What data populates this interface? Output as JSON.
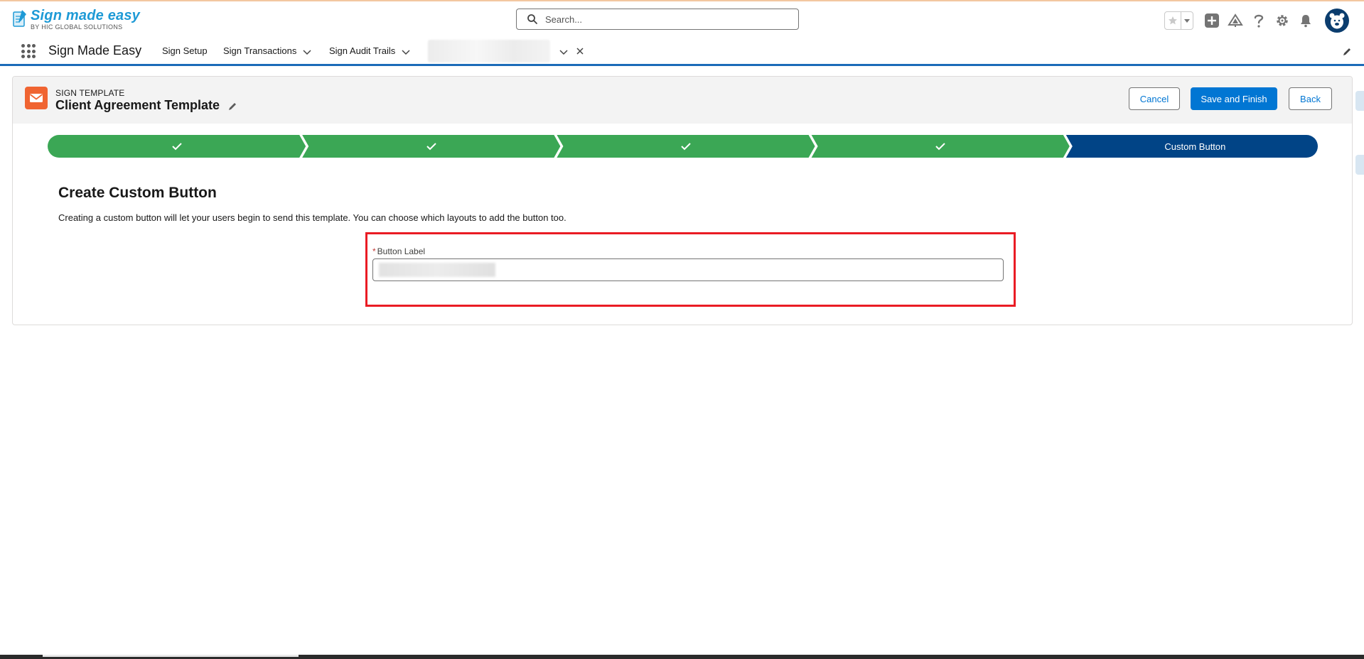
{
  "branding": {
    "logo_title": "Sign made easy",
    "logo_subtitle": "BY HIC GLOBAL SOLUTIONS"
  },
  "search": {
    "placeholder": "Search..."
  },
  "header_icons": [
    "favorites-star-icon",
    "favorites-dropdown-icon",
    "global-actions-plus-icon",
    "trailhead-icon",
    "help-icon",
    "setup-gear-icon",
    "notifications-bell-icon",
    "user-avatar"
  ],
  "nav": {
    "app_name": "Sign Made Easy",
    "items": [
      {
        "label": "Sign Setup",
        "has_menu": false
      },
      {
        "label": "Sign Transactions",
        "has_menu": true
      },
      {
        "label": "Sign Audit Trails",
        "has_menu": true
      }
    ]
  },
  "record": {
    "type": "SIGN TEMPLATE",
    "title": "Client Agreement Template"
  },
  "actions": {
    "cancel": "Cancel",
    "save_finish": "Save and Finish",
    "back": "Back"
  },
  "path": {
    "completed_steps": 4,
    "current_step": "Custom Button"
  },
  "content": {
    "title": "Create Custom Button",
    "description": "Creating a custom button will let your users begin to send this template. You can choose which layouts to add the button too.",
    "field_label": "Button Label",
    "required_marker": "*"
  },
  "colors": {
    "brand": "#0176d3",
    "path_complete": "#3ba755",
    "path_current": "#014486",
    "nav_border": "#1b6bb8",
    "record_icon": "#f06431",
    "highlight": "#ea1c24"
  }
}
